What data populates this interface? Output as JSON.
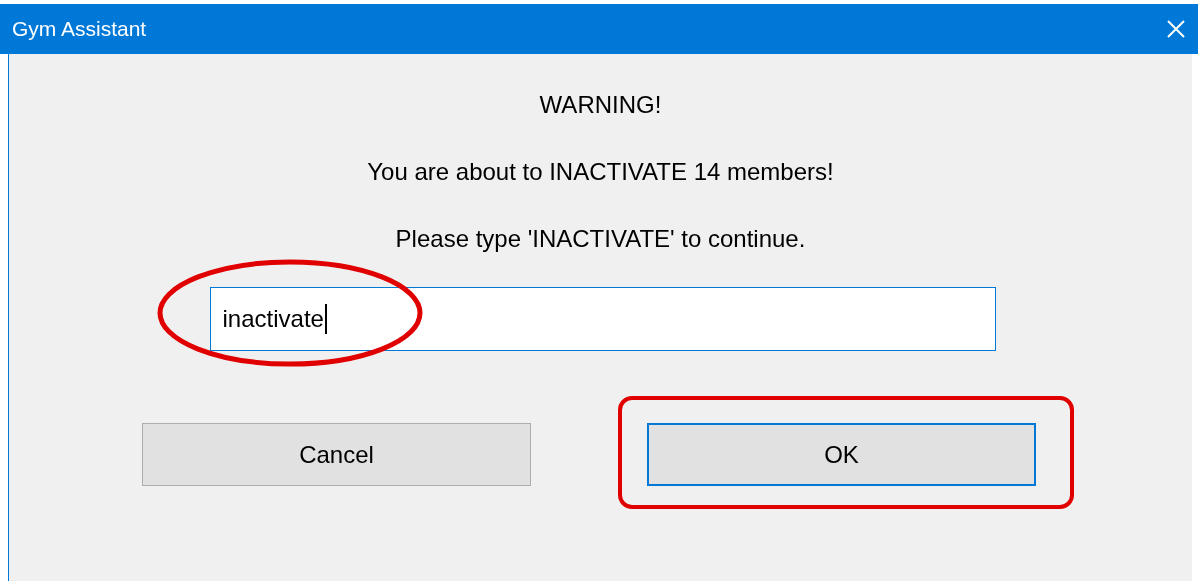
{
  "window": {
    "title": "Gym Assistant"
  },
  "messages": [
    "WARNING!",
    "You are about to INACTIVATE 14 members!",
    "Please type 'INACTIVATE' to continue."
  ],
  "field": {
    "value": "inactivate",
    "focused": true,
    "circled": true
  },
  "buttons": [
    {
      "label": "Cancel",
      "selected": false,
      "boxed": false
    },
    {
      "label": "OK",
      "selected": true,
      "boxed": true
    }
  ]
}
